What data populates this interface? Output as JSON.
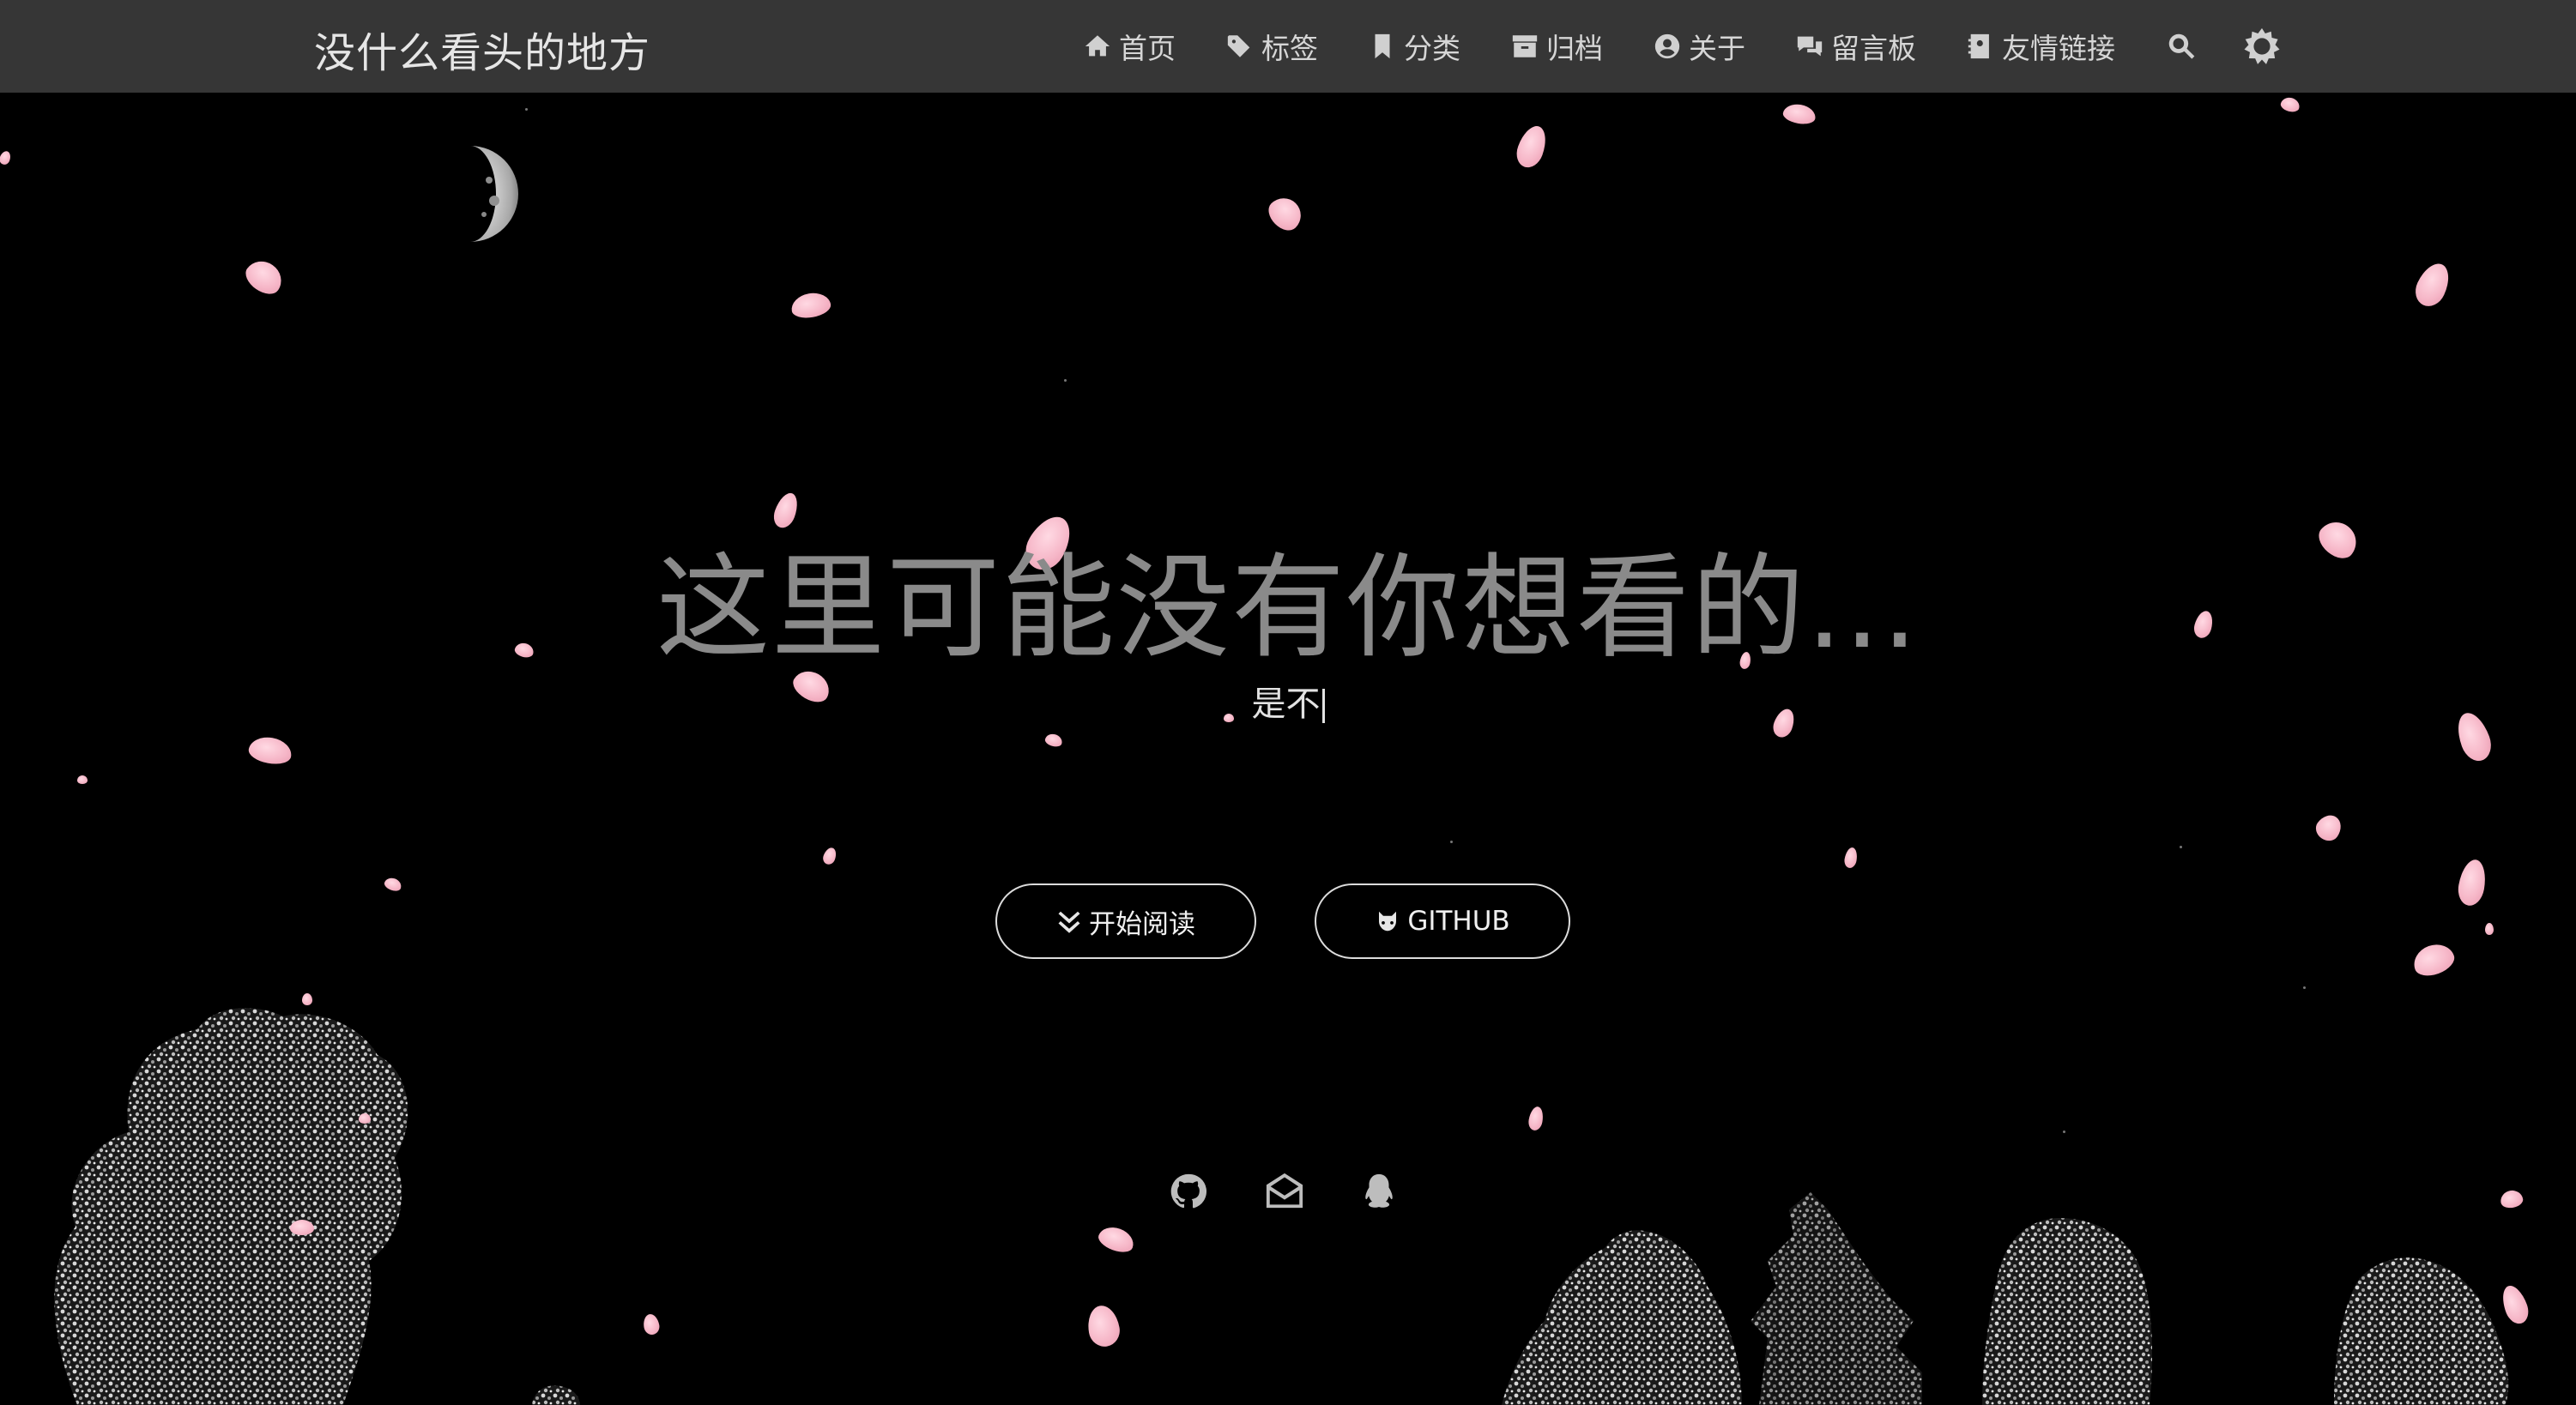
{
  "navbar": {
    "brand": "没什么看头的地方",
    "items": [
      {
        "label": "首页",
        "icon": "home-icon"
      },
      {
        "label": "标签",
        "icon": "tag-icon"
      },
      {
        "label": "分类",
        "icon": "bookmark-icon"
      },
      {
        "label": "归档",
        "icon": "archive-icon"
      },
      {
        "label": "关于",
        "icon": "user-circle-icon"
      },
      {
        "label": "留言板",
        "icon": "comments-icon"
      },
      {
        "label": "友情链接",
        "icon": "address-book-icon"
      }
    ],
    "search_icon": "search-icon",
    "theme_icon": "sun-gear-icon"
  },
  "hero": {
    "title": "这里可能没有你想看的...",
    "subtitle": "是不",
    "buttons": {
      "read_label": "开始阅读",
      "read_icon": "double-chevron-down-icon",
      "github_label": "GITHUB",
      "github_icon": "github-cat-icon"
    },
    "social_icons": [
      "github-icon",
      "envelope-open-icon",
      "qq-penguin-icon"
    ]
  },
  "colors": {
    "navbar_bg": "#363636",
    "page_bg": "#000000",
    "petal": "#f6b7c8",
    "title": "#8a8a8a"
  }
}
